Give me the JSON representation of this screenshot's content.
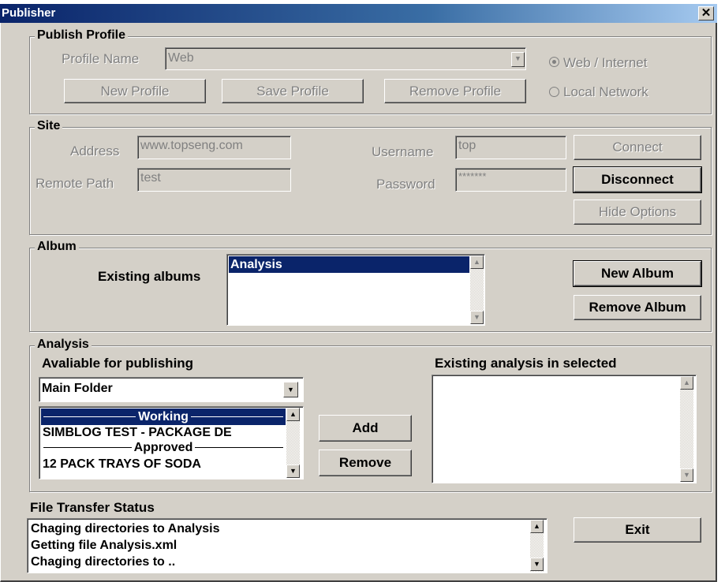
{
  "window": {
    "title": "Publisher",
    "close_glyph": "✕"
  },
  "publish_profile": {
    "legend": "Publish Profile",
    "profile_name_label": "Profile Name",
    "profile_name_value": "Web",
    "new_profile": "New Profile",
    "save_profile": "Save Profile",
    "remove_profile": "Remove Profile",
    "radio_web": "Web / Internet",
    "radio_local": "Local Network",
    "selected_mode": "Web / Internet"
  },
  "site": {
    "legend": "Site",
    "address_label": "Address",
    "address_value": "www.topseng.com",
    "remote_path_label": "Remote Path",
    "remote_path_value": "test",
    "username_label": "Username",
    "username_value": "top",
    "password_label": "Password",
    "password_value": "*******",
    "connect": "Connect",
    "disconnect": "Disconnect",
    "hide_options": "Hide Options"
  },
  "album": {
    "legend": "Album",
    "existing_label": "Existing albums",
    "items": [
      "Analysis"
    ],
    "selected": "Analysis",
    "new_album": "New Album",
    "remove_album": "Remove Album"
  },
  "analysis": {
    "legend": "Analysis",
    "available_label": "Avaliable for publishing",
    "folder_value": "Main Folder",
    "list_items": [
      {
        "text": "Working",
        "kind": "separator",
        "selected": true
      },
      {
        "text": "SIMBLOG TEST - PACKAGE DE",
        "kind": "item",
        "selected": false
      },
      {
        "text": "Approved",
        "kind": "separator",
        "selected": false
      },
      {
        "text": "12 PACK TRAYS OF SODA",
        "kind": "item",
        "selected": false
      }
    ],
    "add": "Add",
    "remove": "Remove",
    "existing_label": "Existing analysis in selected"
  },
  "transfer": {
    "label": "File Transfer Status",
    "lines": [
      "Chaging directories to Analysis",
      "Getting file Analysis.xml",
      "Chaging directories to .."
    ],
    "exit": "Exit"
  },
  "icons": {
    "close": "close-icon",
    "dropdown": "chevron-down-icon",
    "scroll_up": "scroll-up-arrow-icon",
    "scroll_down": "scroll-down-arrow-icon"
  },
  "colors": {
    "face": "#d4d0c8",
    "title_start": "#0a246a",
    "selection": "#0a246a",
    "disabled_text": "#808080"
  }
}
